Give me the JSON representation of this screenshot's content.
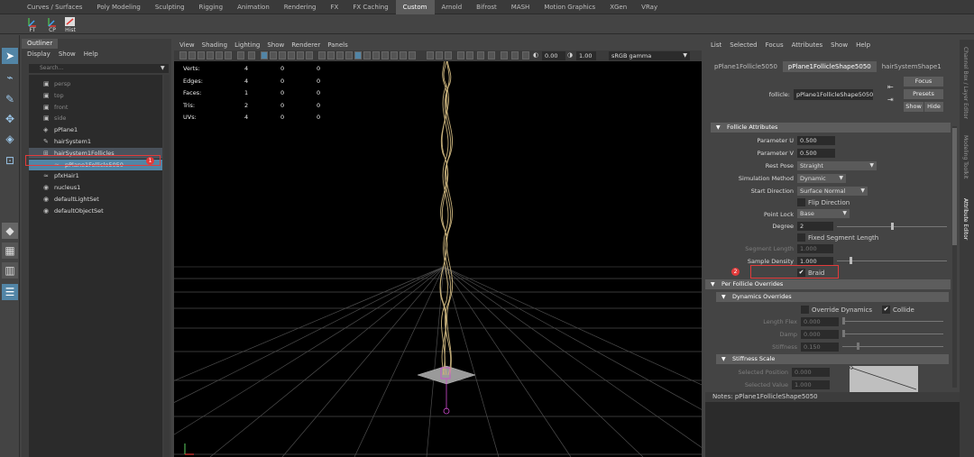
{
  "shelf": {
    "tabs": [
      "Curves / Surfaces",
      "Poly Modeling",
      "Sculpting",
      "Rigging",
      "Animation",
      "Rendering",
      "FX",
      "FX Caching",
      "Custom",
      "Arnold",
      "Bifrost",
      "MASH",
      "Motion Graphics",
      "XGen",
      "VRay"
    ],
    "active_tab": "Custom",
    "buttons": [
      "FT",
      "CP",
      "Hist"
    ]
  },
  "outliner": {
    "tab": "Outliner",
    "menu": [
      "Display",
      "Show",
      "Help"
    ],
    "search_placeholder": "Search...",
    "items": [
      {
        "label": "persp",
        "dim": true
      },
      {
        "label": "top",
        "dim": true
      },
      {
        "label": "front",
        "dim": true
      },
      {
        "label": "side",
        "dim": true
      },
      {
        "label": "pPlane1",
        "dim": false
      },
      {
        "label": "hairSystem1",
        "dim": false
      },
      {
        "label": "hairSystem1Follicles",
        "dim": false
      },
      {
        "label": "pPlane1Follicle5050",
        "dim": false
      },
      {
        "label": "pfxHair1",
        "dim": false
      },
      {
        "label": "nucleus1",
        "dim": false
      },
      {
        "label": "defaultLightSet",
        "dim": false
      },
      {
        "label": "defaultObjectSet",
        "dim": false
      }
    ],
    "badge": "1"
  },
  "viewport": {
    "menu": [
      "View",
      "Shading",
      "Lighting",
      "Show",
      "Renderer",
      "Panels"
    ],
    "exposure": "0.00",
    "gamma": "1.00",
    "color_space": "sRGB gamma",
    "hud": [
      {
        "label": "Verts:",
        "a": "4",
        "b": "0",
        "c": "0"
      },
      {
        "label": "Edges:",
        "a": "4",
        "b": "0",
        "c": "0"
      },
      {
        "label": "Faces:",
        "a": "1",
        "b": "0",
        "c": "0"
      },
      {
        "label": "Tris:",
        "a": "2",
        "b": "0",
        "c": "0"
      },
      {
        "label": "UVs:",
        "a": "4",
        "b": "0",
        "c": "0"
      }
    ]
  },
  "attribute_editor": {
    "menu": [
      "List",
      "Selected",
      "Focus",
      "Attributes",
      "Show",
      "Help"
    ],
    "tabs": [
      "pPlane1Follicle5050",
      "pPlane1FollicleShape5050",
      "hairSystemShape1"
    ],
    "active_tab": "pPlane1FollicleShape5050",
    "node_label": "follicle:",
    "node_name": "pPlane1FollicleShape5050",
    "focus": "Focus",
    "presets": "Presets",
    "show": "Show",
    "hide": "Hide",
    "follicle_section": "Follicle Attributes",
    "parameter_u_label": "Parameter U",
    "parameter_u": "0.500",
    "parameter_v_label": "Parameter V",
    "parameter_v": "0.500",
    "rest_pose_label": "Rest Pose",
    "rest_pose": "Straight",
    "sim_method_label": "Simulation Method",
    "sim_method": "Dynamic",
    "start_dir_label": "Start Direction",
    "start_dir": "Surface Normal",
    "flip_direction": "Flip Direction",
    "point_lock_label": "Point Lock",
    "point_lock": "Base",
    "degree_label": "Degree",
    "degree": "2",
    "fixed_segment_length": "Fixed Segment Length",
    "segment_length_label": "Segment Length",
    "segment_length": "1.000",
    "sample_density_label": "Sample Density",
    "sample_density": "1.000",
    "braid": "Braid",
    "braid_checked": true,
    "per_follicle_section": "Per Follicle Overrides",
    "dynamics_section": "Dynamics Overrides",
    "override_dynamics": "Override Dynamics",
    "collide": "Collide",
    "length_flex_label": "Length Flex",
    "length_flex": "0.000",
    "damp_label": "Damp",
    "damp": "0.000",
    "stiffness_label": "Stiffness",
    "stiffness": "0.150",
    "stiffness_scale_section": "Stiffness Scale",
    "selected_position_label": "Selected Position",
    "selected_position": "0.000",
    "selected_value_label": "Selected Value",
    "selected_value": "1.000",
    "badge": "2",
    "notes_label": "Notes:",
    "notes_node": "pPlane1FollicleShape5050"
  },
  "side_tabs": [
    "Channel Box / Layer Editor",
    "Modeling Toolkit",
    "Attribute Editor"
  ],
  "active_side_tab": "Attribute Editor",
  "colors": {
    "accent": "#5285a6",
    "annotation": "#e23b3b",
    "hair": "#c9b27c",
    "grid": "#555555"
  }
}
